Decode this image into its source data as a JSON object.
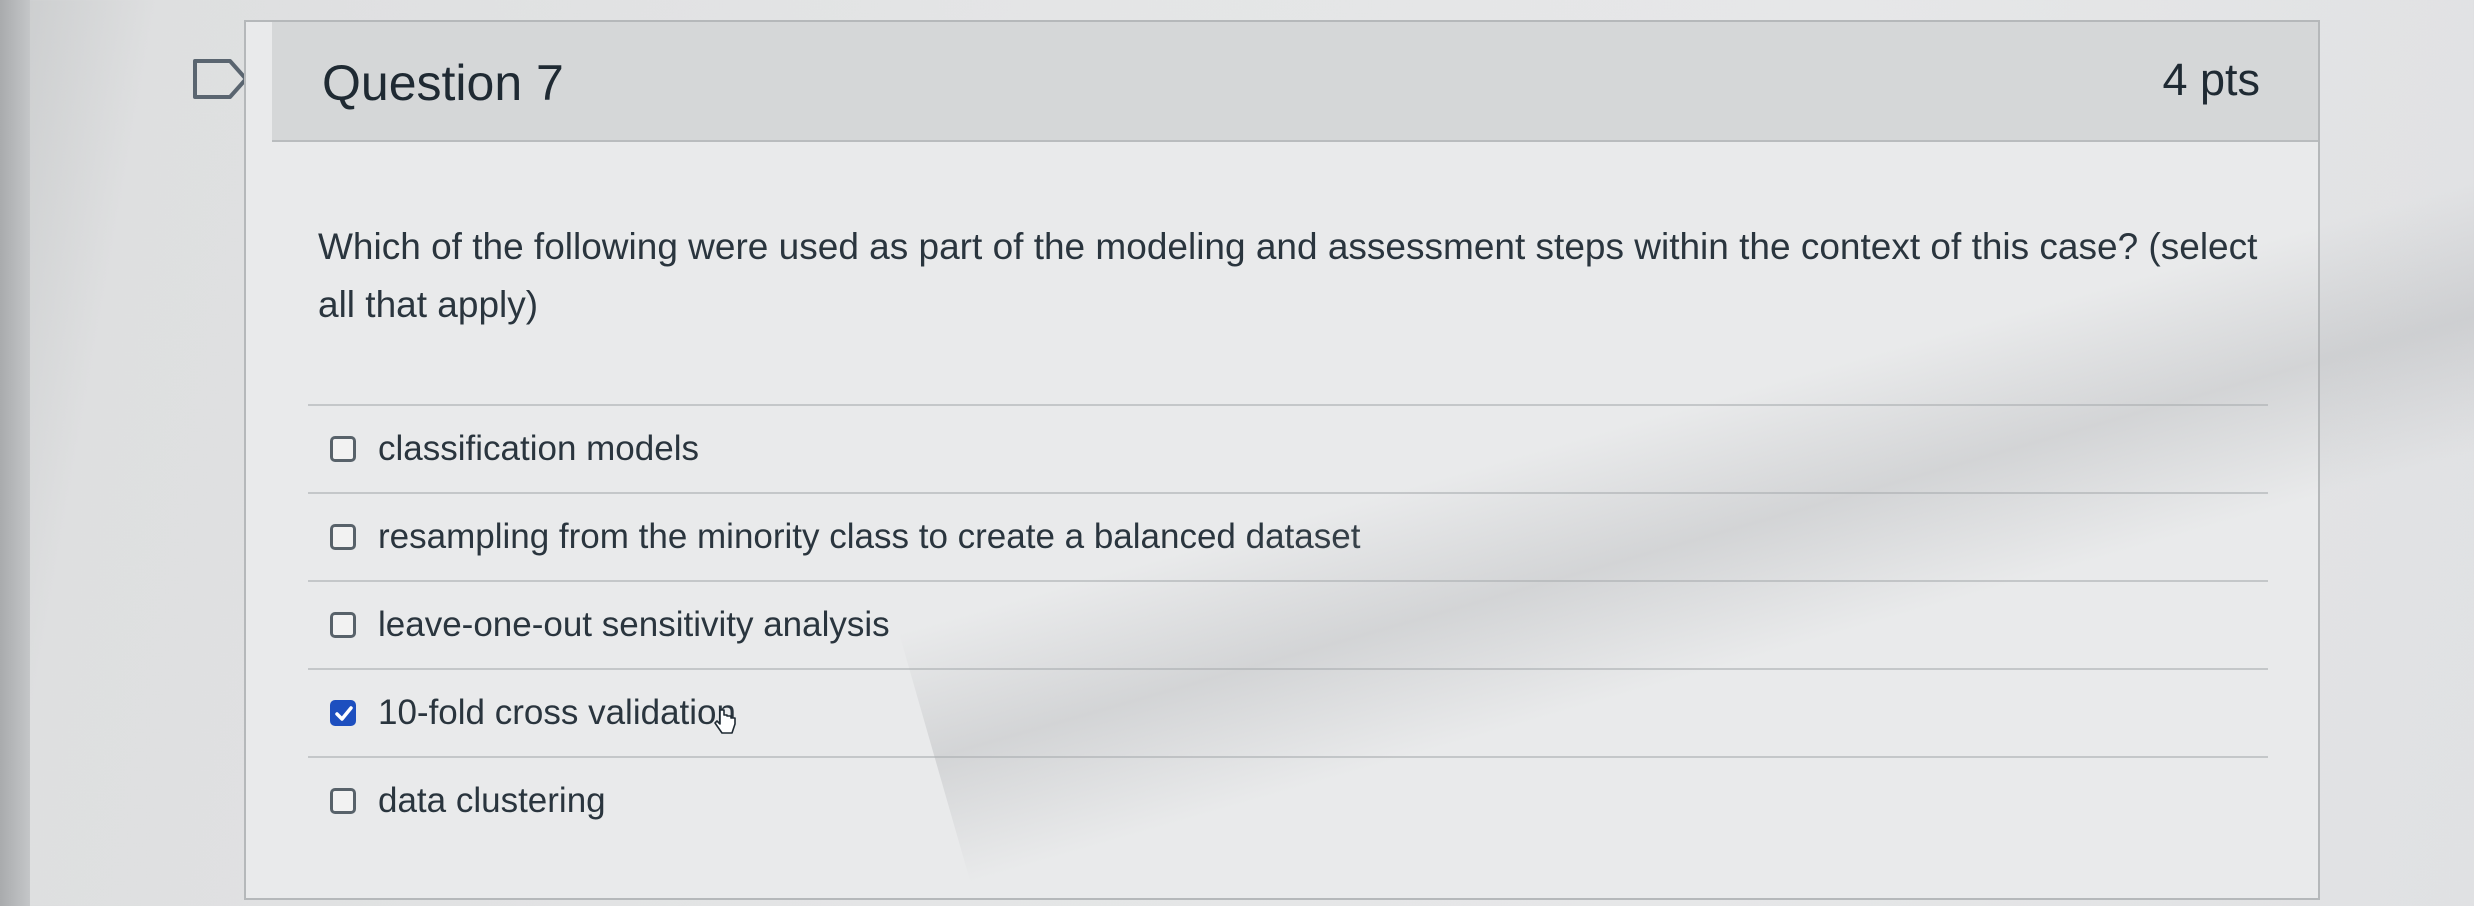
{
  "question": {
    "title": "Question 7",
    "points": "4 pts",
    "text": "Which of the following were used as part of the modeling and assessment steps within the context of this case? (select all that apply)"
  },
  "answers": [
    {
      "label": "classification models",
      "checked": false
    },
    {
      "label": "resampling from the minority class to create a balanced dataset",
      "checked": false
    },
    {
      "label": "leave-one-out sensitivity analysis",
      "checked": false
    },
    {
      "label": "10-fold cross validation",
      "checked": true
    },
    {
      "label": "data clustering",
      "checked": false
    }
  ],
  "colors": {
    "accent": "#1d4fbf",
    "header_bg": "#d5d7d8",
    "text": "#2a353e"
  },
  "icons": {
    "flag": "flag-icon",
    "checkbox": "checkbox-icon",
    "cursor": "pointer-cursor-icon"
  }
}
